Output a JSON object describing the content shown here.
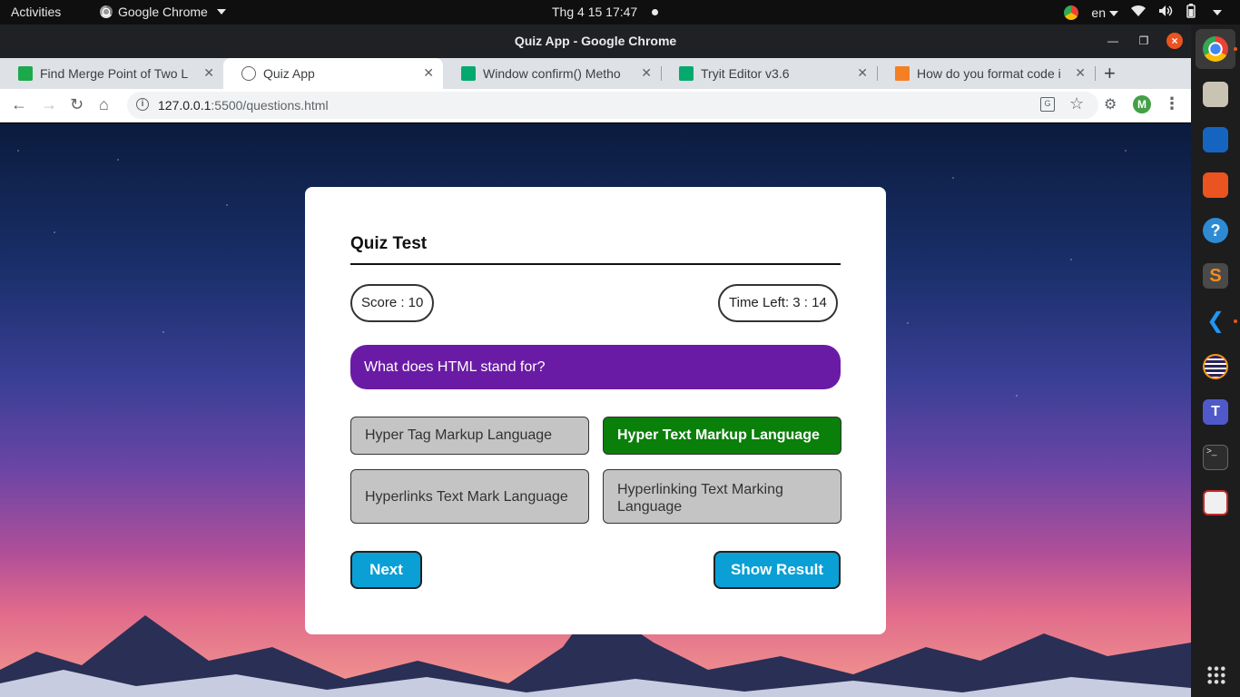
{
  "topbar": {
    "activities": "Activities",
    "app_name": "Google Chrome",
    "clock": "Thg 4 15  17:47",
    "lang": "en"
  },
  "window": {
    "title": "Quiz App - Google Chrome"
  },
  "tabs": [
    {
      "label": "Find Merge Point of Two L",
      "favicon": "hackerrank-icon",
      "color": "#1ba94c"
    },
    {
      "label": "Quiz App",
      "favicon": "globe-icon",
      "active": true
    },
    {
      "label": "Window confirm() Metho",
      "favicon": "w3schools-icon",
      "color": "#04aa6d"
    },
    {
      "label": "Tryit Editor v3.6",
      "favicon": "w3schools-icon",
      "color": "#04aa6d"
    },
    {
      "label": "How do you format code i",
      "favicon": "stackoverflow-icon",
      "color": "#f48024"
    }
  ],
  "omnibox": {
    "host": "127.0.0.1",
    "path": ":5500/questions.html"
  },
  "profile_initial": "M",
  "quiz": {
    "title": "Quiz Test",
    "score_text": "Score : 10",
    "time_text": "Time Left: 3 : 14",
    "question": "What does HTML stand for?",
    "options": [
      {
        "label": "Hyper Tag Markup Language",
        "state": "default"
      },
      {
        "label": "Hyper Text Markup Language",
        "state": "correct"
      },
      {
        "label": "Hyperlinks Text Mark Language",
        "state": "default"
      },
      {
        "label": "Hyperlinking Text Marking Language",
        "state": "default"
      }
    ],
    "next_label": "Next",
    "result_label": "Show Result"
  },
  "colors": {
    "question_bg": "#6a1ba5",
    "correct_bg": "#0a7f0a",
    "option_bg": "#c4c4c4",
    "button_bg": "#0a9fd5"
  },
  "dock": [
    "chrome-icon",
    "files-icon",
    "writer-icon",
    "software-icon",
    "help-icon",
    "sublime-icon",
    "vscode-icon",
    "eclipse-icon",
    "teams-icon",
    "terminal-icon",
    "document-viewer-icon"
  ]
}
